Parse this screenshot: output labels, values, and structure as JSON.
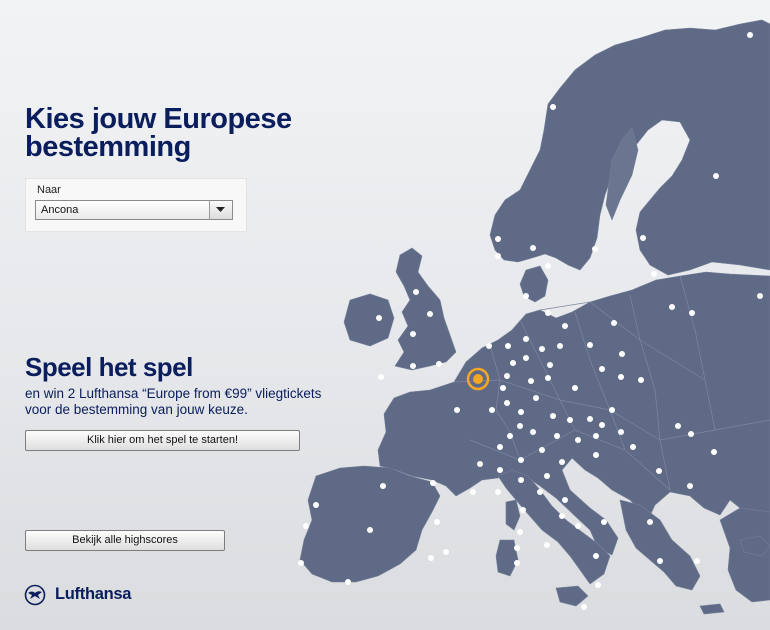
{
  "header": {
    "title_line1": "Kies jouw Europese",
    "title_line2": "bestemming"
  },
  "destination": {
    "label": "Naar",
    "selected": "Ancona"
  },
  "game": {
    "title": "Speel het spel",
    "desc_line1": "en win 2 Lufthansa “Europe from €99” vliegtickets",
    "desc_line2": "voor de bestemming van jouw keuze.",
    "start_button": "Klik hier om het spel te starten!"
  },
  "highscores_button": "Bekijk alle highscores",
  "brand": {
    "name": "Lufthansa",
    "color": "#0a1d5c"
  },
  "map": {
    "land_color": "#5f6b86",
    "dot_color": "#ffffff",
    "selected_marker_color": "#f5a623"
  }
}
